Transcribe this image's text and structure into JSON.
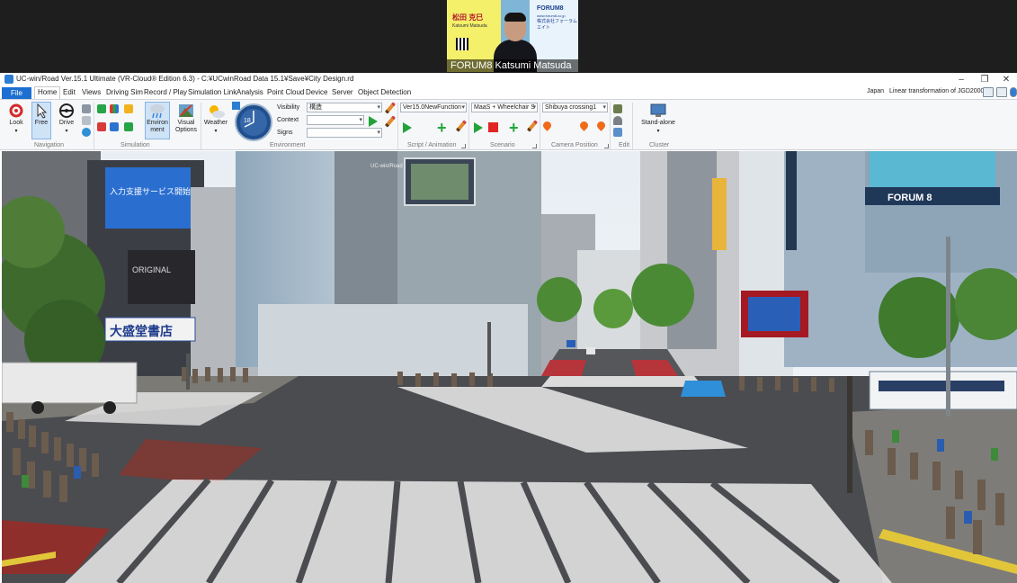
{
  "call": {
    "participant_name": "FORUM8 Katsumi Matsuda",
    "poster_name": "松田 克巳",
    "poster_sub": "Katsumi Matsuda",
    "poster_brand": "FORUM8",
    "poster_url": "www.forum8.co.jp",
    "poster_brand_jp": "株式会社フォーラムエイト"
  },
  "window": {
    "title": "UC-win/Road Ver.15.1 Ultimate (VR-Cloud® Edition 6.3) - C:¥UCwinRoad Data 15.1¥Save¥City Design.rd",
    "minimize_glyph": "–",
    "maximize_glyph": "❐",
    "close_glyph": "✕"
  },
  "menu": {
    "file": "File",
    "items": [
      "Home",
      "Edit",
      "Views",
      "Driving Sim",
      "Record / Play",
      "Simulation Link",
      "Analysis",
      "Point Cloud",
      "Device",
      "Server",
      "Object Detection"
    ],
    "region": "Japan",
    "coordinate_system": "Linear transformation of JGD2000"
  },
  "ribbon": {
    "navigation": {
      "label": "Navigation",
      "look": "Look",
      "free": "Free",
      "drive": "Drive"
    },
    "simulation": {
      "label": "Simulation",
      "environment": "Environ\nment",
      "visual_options": "Visual\nOptions"
    },
    "environment": {
      "label": "Environment",
      "weather": "Weather",
      "visibility_label": "Visibility",
      "visibility_value": "構造",
      "context_label": "Context",
      "context_value": "",
      "signs_label": "Signs",
      "signs_value": "",
      "clock_hour": "18"
    },
    "script": {
      "label": "Script / Animation",
      "value": "Ver15.0NewFunction"
    },
    "scenario": {
      "label": "Scenario",
      "value": "MaaS + Wheelchair S"
    },
    "camera": {
      "label": "Camera Position",
      "value": "Shibuya crossing1"
    },
    "edit": {
      "label": "Edit"
    },
    "cluster": {
      "label": "Cluster",
      "standalone": "Stand-alone"
    }
  },
  "viewport": {
    "scene": "Shibuya crossing",
    "billboard_center_text": "UC-win/Road",
    "billboard_left_1": "入力支援サービス開始",
    "billboard_left_2": "大盛堂書店",
    "billboard_right_brand": "FORUM 8",
    "billboard_right_2": "ORIGINAL"
  }
}
